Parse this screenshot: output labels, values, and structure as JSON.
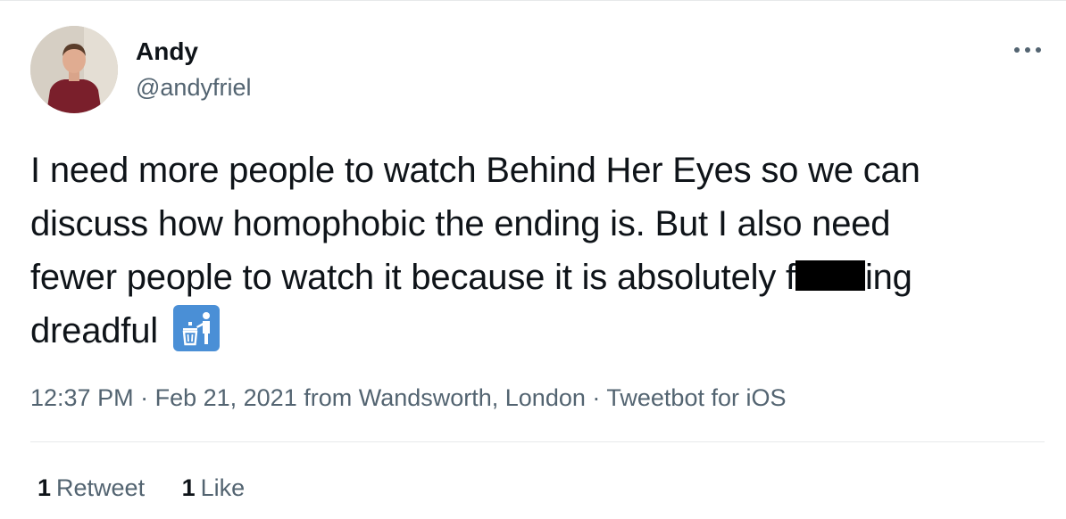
{
  "tweet": {
    "author": {
      "name": "Andy",
      "handle": "@andyfriel",
      "avatar_icon": "user-avatar"
    },
    "more_icon": "more-horizontal-icon",
    "text": {
      "line1": "I need more people to watch Behind Her Eyes so we can",
      "line2": "discuss how homophobic the ending is. But I also need",
      "line3_before": "fewer people to watch it because it is absolutely f",
      "line3_after": "ing",
      "line4": "dreadful",
      "emoji": "wastebasket-emoji"
    },
    "meta": {
      "time": "12:37 PM",
      "sep1": " · ",
      "date": "Feb 21, 2021",
      "location": " from Wandsworth, London",
      "sep2": " · ",
      "client": "Tweetbot for iOS"
    },
    "stats": {
      "retweets_count": "1",
      "retweets_label": "Retweet",
      "likes_count": "1",
      "likes_label": "Like"
    }
  },
  "colors": {
    "text": "#0f1419",
    "secondary": "#536471",
    "divider": "#e7e9ea",
    "emoji_bg": "#4a8fd6",
    "redaction": "#000000"
  }
}
